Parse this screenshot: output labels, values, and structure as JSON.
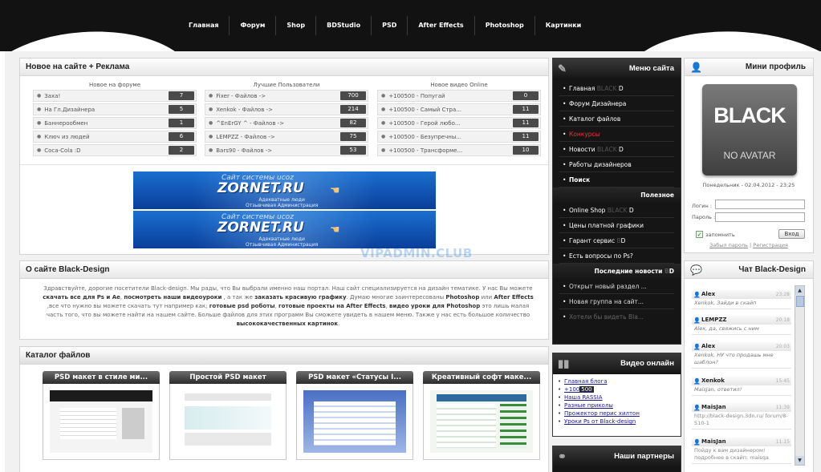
{
  "nav": {
    "items": [
      "Главная",
      "Форум",
      "Shop",
      "BDStudio",
      "PSD",
      "After Effects",
      "Photoshop",
      "Картинки"
    ]
  },
  "news_panel": {
    "title": "Новое на сайте + Реклама",
    "forum": {
      "title": "Новое на форуме",
      "rows": [
        {
          "text": "Заха!",
          "count": "7"
        },
        {
          "text": "На Гл.Дизайнера",
          "count": "5"
        },
        {
          "text": "Баннерообмен",
          "count": "1"
        },
        {
          "text": "Ключ из людей",
          "count": "6"
        },
        {
          "text": "Coca-Cola :D",
          "count": "2"
        }
      ]
    },
    "users": {
      "title": "Лучшие Пользователи",
      "rows": [
        {
          "text": "Fixer - Файлов ->",
          "count": "700"
        },
        {
          "text": "Xenkok - Файлов ->",
          "count": "214"
        },
        {
          "text": "^EnErGY ^ - Файлов ->",
          "count": "82"
        },
        {
          "text": "LEMPZZ - Файлов ->",
          "count": "75"
        },
        {
          "text": "Bars90 - Файлов ->",
          "count": "53"
        }
      ]
    },
    "video": {
      "title": "Новое видео Online",
      "rows": [
        {
          "text": "+100500 - Попугай",
          "count": "0"
        },
        {
          "text": "+100500 - Самый Стра...",
          "count": "11"
        },
        {
          "text": "+100500 - Герой любо...",
          "count": "11"
        },
        {
          "text": "+100500 - Безупречны...",
          "count": "11"
        },
        {
          "text": "+100500 - Трансформе...",
          "count": "10"
        }
      ]
    },
    "banner": {
      "caption": "Сайт системы ucoz",
      "logo": "ZORNET.RU",
      "line1": "Адекватные люди",
      "line2": "Отзывчивая Администрация"
    }
  },
  "about": {
    "title": "О сайте Black-Design",
    "parts": [
      "Здравствуйте, дорогие посетители Black-design. Мы рады, что Вы выбрали именно наш портал. Наш сайт специализируется на дизайн тематике. У нас Вы можете ",
      "скачать все для  Ps и Ae",
      ", ",
      "посмотреть наши видеоуроки",
      " , а так же ",
      "заказать красивую графику",
      ". Думаю многие заинтересованы ",
      "Photoshop",
      " или ",
      "After Effects",
      " ,все что нужно вы можете скачать тут например как; ",
      "готовые psd роботы",
      ", ",
      "готовые проекты на After Effects",
      ", ",
      "видео уроки для Photoshop",
      " это лишь малая часть того, что вы можете найти  на нашем сайте. Больше файлов для этих  программ Вы сможете увидеть в нашем меню. Также у нас есть большое количество ",
      "высококачественных картинок",
      "."
    ]
  },
  "catalog": {
    "title": "Каталог файлов",
    "cards": [
      {
        "title": "PSD макет в стиле ми..."
      },
      {
        "title": "Простой PSD макет"
      },
      {
        "title": "PSD макет «Статусы I..."
      },
      {
        "title": "Креативный софт маке..."
      }
    ]
  },
  "site_menu": {
    "title": "Меню сайта",
    "items": [
      {
        "pre": "Главная ",
        "grey": "BLACK",
        "post": " D",
        "red": false,
        "bold": false
      },
      {
        "pre": "Форум Дизайнера",
        "grey": "",
        "post": "",
        "red": false,
        "bold": false
      },
      {
        "pre": "Каталог файлов",
        "grey": "",
        "post": "",
        "red": false,
        "bold": false
      },
      {
        "pre": "Конкурсы",
        "grey": "",
        "post": "",
        "red": true,
        "bold": false
      },
      {
        "pre": "Новости ",
        "grey": "BLACK",
        "post": " D",
        "red": false,
        "bold": false
      },
      {
        "pre": "Работы дизайнеров",
        "grey": "",
        "post": "",
        "red": false,
        "bold": false
      },
      {
        "pre": "Поиск",
        "grey": "",
        "post": "",
        "red": false,
        "bold": true
      }
    ],
    "useful_title": "Полезное",
    "useful_items": [
      {
        "pre": "Online Shop ",
        "grey": "BLACK",
        "post": " D"
      },
      {
        "pre": "Цены платной графики",
        "grey": "",
        "post": ""
      },
      {
        "pre": "Гарант сервис ",
        "grey": "B",
        "post": "D"
      },
      {
        "pre": "Есть вопросы по Ps?",
        "grey": "",
        "post": ""
      }
    ],
    "news_title": "Последние новости",
    "news_title_grey": "B",
    "news_title_post": "D",
    "news_items": [
      "Открыт новый раздел ...",
      "Новая группа на сайт...",
      "Хотели бы видеть Bla..."
    ]
  },
  "video_online": {
    "title": "Видео онлайн",
    "items": [
      "Главная блога",
      "Наша RASSIA",
      "Разные приколы",
      "Прожектор перис хилтон",
      "Уроки Ps от Black-design"
    ],
    "badge_pre": "+100",
    "badge": "500"
  },
  "partners": {
    "title": "Наши партнеры"
  },
  "mini_profile": {
    "title": "Мини профиль",
    "avatar_main": "BLACK",
    "avatar_sub": "NO AVATAR",
    "date_line": "Понедельник - 02.04.2012 - 23:25",
    "login_label": "Логин :",
    "password_label": "Пароль :",
    "remember": "запомнить",
    "login_button": "Вход",
    "forgot": "Забыл пароль",
    "separator": "|",
    "register": "Регистрация"
  },
  "chat": {
    "title": "Чат Black-Design",
    "messages": [
      {
        "user": "Alex",
        "time": "23:28",
        "text": "Xenkok, Зайди в скайп"
      },
      {
        "user": "LEMPZZ",
        "time": "20:18",
        "text": "Alex, да, свяжись с ним"
      },
      {
        "user": "Alex",
        "time": "20:03",
        "text": "Xenkok, НУ что продашь мне шаблон?"
      },
      {
        "user": "Xenkok",
        "time": "15:45",
        "text": "MaisJan, ответил!"
      },
      {
        "user": "MaisJan",
        "time": "11:39",
        "text": "http://black-design.3dn.ru/ forum/8-510-1"
      },
      {
        "user": "MaisJan",
        "time": "11:15",
        "text": "Пойду к вам дизайнером! подробнее в скайп: maisqa"
      }
    ]
  },
  "watermark": "VIPADMIN.CLUB",
  "colors": {
    "accent_red": "#e23a3a",
    "dark_bg": "#151515",
    "link": "#1a1a8a"
  }
}
